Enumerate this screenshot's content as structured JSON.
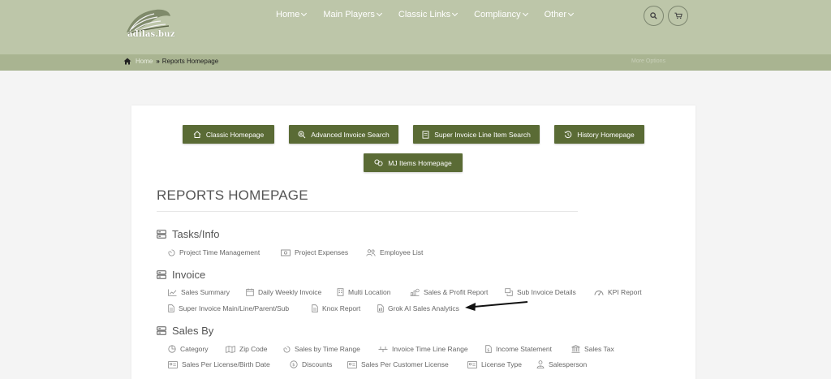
{
  "header": {
    "logo_text": "adilas.buz",
    "nav": [
      {
        "label": "Home"
      },
      {
        "label": "Main Players"
      },
      {
        "label": "Classic Links"
      },
      {
        "label": "Compliancy"
      },
      {
        "label": "Other"
      }
    ]
  },
  "breadcrumb": {
    "home": "Home",
    "current": "Reports Homepage",
    "more_options": "More Options"
  },
  "buttons": {
    "classic": "Classic Homepage",
    "advanced_search": "Advanced Invoice Search",
    "line_item_search": "Super Invoice Line Item Search",
    "history": "History Homepage",
    "mj_items": "MJ Items Homepage"
  },
  "page_title": "REPORTS HOMEPAGE",
  "sections": {
    "tasks": {
      "title": "Tasks/Info",
      "links": [
        "Project Time Management",
        "Project Expenses",
        "Employee List"
      ]
    },
    "invoice": {
      "title": "Invoice",
      "links": [
        "Sales Summary",
        "Daily Weekly Invoice",
        "Multi Location",
        "Sales & Profit Report",
        "Sub Invoice Details",
        "KPI Report",
        "Super Invoice Main/Line/Parent/Sub",
        "Knox Report",
        "Grok AI Sales Analytics"
      ]
    },
    "sales_by": {
      "title": "Sales By",
      "links": [
        "Category",
        "Zip Code",
        "Sales by Time Range",
        "Invoice Time Line Range",
        "Income Statement",
        "Sales Tax",
        "Sales Per License/Birth Date",
        "Discounts",
        "Sales Per Customer License",
        "License Type",
        "Salesperson"
      ]
    }
  },
  "colors": {
    "header_bg": "#bdc6a9",
    "crumb_bg": "#a9b491",
    "button_bg": "#5a6b35"
  }
}
